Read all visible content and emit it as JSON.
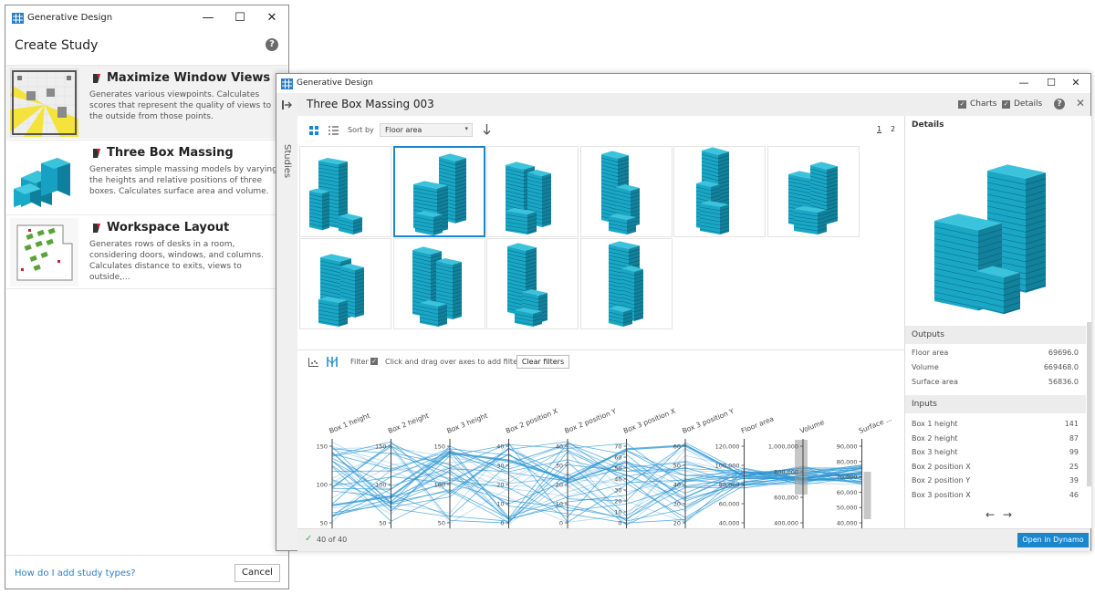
{
  "create_window": {
    "title": "Generative Design",
    "header": "Create Study",
    "studies": [
      {
        "name": "Maximize Window Views",
        "description": "Generates various viewpoints. Calculates scores that represent the quality of views to the outside from those points."
      },
      {
        "name": "Three Box Massing",
        "description": "Generates simple massing models by varying the heights and relative positions of three boxes. Calculates surface area and volume."
      },
      {
        "name": "Workspace Layout",
        "description": "Generates rows of desks in a room, considering doors, windows, and columns. Calculates distance to exits, views to outside,..."
      }
    ],
    "help_link": "How do I add study types?",
    "cancel_label": "Cancel"
  },
  "explore_window": {
    "title": "Generative Design",
    "sidebar_label": "Studies",
    "study_title": "Three Box Massing 003",
    "charts_label": "Charts",
    "details_label": "Details",
    "sort_by_label": "Sort by",
    "sort_value": "Floor area",
    "pages": [
      "1",
      "2"
    ],
    "selected_index": 1,
    "filter_label": "Filter",
    "filter_hint": "Click and drag over axes to add filters",
    "clear_filters_label": "Clear filters",
    "status": "40 of 40",
    "open_dynamo_label": "Open in Dynamo",
    "details": {
      "heading": "Details",
      "outputs_heading": "Outputs",
      "outputs": [
        {
          "label": "Floor area",
          "value": "69696.0"
        },
        {
          "label": "Volume",
          "value": "669468.0"
        },
        {
          "label": "Surface area",
          "value": "56836.0"
        }
      ],
      "inputs_heading": "Inputs",
      "inputs": [
        {
          "label": "Box 1 height",
          "value": "141"
        },
        {
          "label": "Box 2 height",
          "value": "87"
        },
        {
          "label": "Box 3 height",
          "value": "99"
        },
        {
          "label": "Box 2 position X",
          "value": "25"
        },
        {
          "label": "Box 2 position Y",
          "value": "39"
        },
        {
          "label": "Box 3 position X",
          "value": "46"
        }
      ]
    }
  },
  "colors": {
    "accent": "#1a86cf",
    "building": "#1aa7c6",
    "building_dark": "#12819c",
    "building_top": "#3cc3dc",
    "line": "#2a95d3"
  },
  "chart_data": {
    "type": "parallel_coordinates",
    "axes": [
      {
        "label": "Box 1 height",
        "ticks": [
          "150",
          "100",
          "50"
        ]
      },
      {
        "label": "Box 2 height",
        "ticks": [
          "150",
          "100",
          "50"
        ]
      },
      {
        "label": "Box 3 height",
        "ticks": [
          "150",
          "100",
          "50"
        ]
      },
      {
        "label": "Box 2 position X",
        "ticks": [
          "40",
          "30",
          "20",
          "10",
          "0"
        ]
      },
      {
        "label": "Box 2 position Y",
        "ticks": [
          "40",
          "30",
          "20",
          "10",
          "0"
        ]
      },
      {
        "label": "Box 3 position X",
        "ticks": [
          "70",
          "60",
          "50",
          "40",
          "30",
          "20",
          "10",
          "0"
        ]
      },
      {
        "label": "Box 3 position Y",
        "ticks": [
          "60",
          "50",
          "40",
          "30",
          "20"
        ]
      },
      {
        "label": "Floor area",
        "ticks": [
          "120,000",
          "100,000",
          "80,000",
          "60,000",
          "40,000"
        ]
      },
      {
        "label": "Volume",
        "ticks": [
          "1,000,000",
          "800,000",
          "600,000",
          "400,000"
        ]
      },
      {
        "label": "Surface ...",
        "ticks": [
          "90,000",
          "80,000",
          "70,000",
          "60,000",
          "50,000",
          "40,000"
        ]
      }
    ]
  }
}
